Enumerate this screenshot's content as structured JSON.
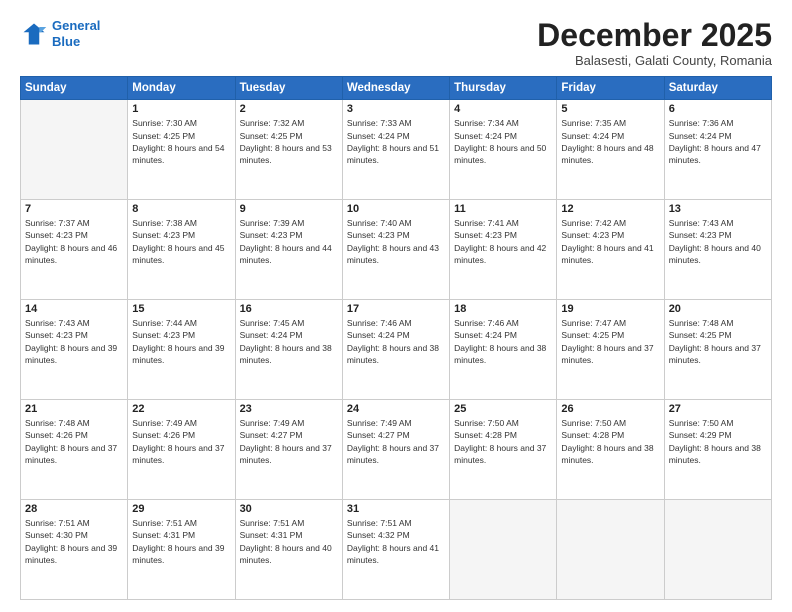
{
  "logo": {
    "line1": "General",
    "line2": "Blue"
  },
  "header": {
    "month": "December 2025",
    "location": "Balasesti, Galati County, Romania"
  },
  "weekdays": [
    "Sunday",
    "Monday",
    "Tuesday",
    "Wednesday",
    "Thursday",
    "Friday",
    "Saturday"
  ],
  "weeks": [
    [
      {
        "day": "",
        "empty": true
      },
      {
        "day": "1",
        "sunrise": "7:30 AM",
        "sunset": "4:25 PM",
        "daylight": "8 hours and 54 minutes."
      },
      {
        "day": "2",
        "sunrise": "7:32 AM",
        "sunset": "4:25 PM",
        "daylight": "8 hours and 53 minutes."
      },
      {
        "day": "3",
        "sunrise": "7:33 AM",
        "sunset": "4:24 PM",
        "daylight": "8 hours and 51 minutes."
      },
      {
        "day": "4",
        "sunrise": "7:34 AM",
        "sunset": "4:24 PM",
        "daylight": "8 hours and 50 minutes."
      },
      {
        "day": "5",
        "sunrise": "7:35 AM",
        "sunset": "4:24 PM",
        "daylight": "8 hours and 48 minutes."
      },
      {
        "day": "6",
        "sunrise": "7:36 AM",
        "sunset": "4:24 PM",
        "daylight": "8 hours and 47 minutes."
      }
    ],
    [
      {
        "day": "7",
        "sunrise": "7:37 AM",
        "sunset": "4:23 PM",
        "daylight": "8 hours and 46 minutes."
      },
      {
        "day": "8",
        "sunrise": "7:38 AM",
        "sunset": "4:23 PM",
        "daylight": "8 hours and 45 minutes."
      },
      {
        "day": "9",
        "sunrise": "7:39 AM",
        "sunset": "4:23 PM",
        "daylight": "8 hours and 44 minutes."
      },
      {
        "day": "10",
        "sunrise": "7:40 AM",
        "sunset": "4:23 PM",
        "daylight": "8 hours and 43 minutes."
      },
      {
        "day": "11",
        "sunrise": "7:41 AM",
        "sunset": "4:23 PM",
        "daylight": "8 hours and 42 minutes."
      },
      {
        "day": "12",
        "sunrise": "7:42 AM",
        "sunset": "4:23 PM",
        "daylight": "8 hours and 41 minutes."
      },
      {
        "day": "13",
        "sunrise": "7:43 AM",
        "sunset": "4:23 PM",
        "daylight": "8 hours and 40 minutes."
      }
    ],
    [
      {
        "day": "14",
        "sunrise": "7:43 AM",
        "sunset": "4:23 PM",
        "daylight": "8 hours and 39 minutes."
      },
      {
        "day": "15",
        "sunrise": "7:44 AM",
        "sunset": "4:23 PM",
        "daylight": "8 hours and 39 minutes."
      },
      {
        "day": "16",
        "sunrise": "7:45 AM",
        "sunset": "4:24 PM",
        "daylight": "8 hours and 38 minutes."
      },
      {
        "day": "17",
        "sunrise": "7:46 AM",
        "sunset": "4:24 PM",
        "daylight": "8 hours and 38 minutes."
      },
      {
        "day": "18",
        "sunrise": "7:46 AM",
        "sunset": "4:24 PM",
        "daylight": "8 hours and 38 minutes."
      },
      {
        "day": "19",
        "sunrise": "7:47 AM",
        "sunset": "4:25 PM",
        "daylight": "8 hours and 37 minutes."
      },
      {
        "day": "20",
        "sunrise": "7:48 AM",
        "sunset": "4:25 PM",
        "daylight": "8 hours and 37 minutes."
      }
    ],
    [
      {
        "day": "21",
        "sunrise": "7:48 AM",
        "sunset": "4:26 PM",
        "daylight": "8 hours and 37 minutes."
      },
      {
        "day": "22",
        "sunrise": "7:49 AM",
        "sunset": "4:26 PM",
        "daylight": "8 hours and 37 minutes."
      },
      {
        "day": "23",
        "sunrise": "7:49 AM",
        "sunset": "4:27 PM",
        "daylight": "8 hours and 37 minutes."
      },
      {
        "day": "24",
        "sunrise": "7:49 AM",
        "sunset": "4:27 PM",
        "daylight": "8 hours and 37 minutes."
      },
      {
        "day": "25",
        "sunrise": "7:50 AM",
        "sunset": "4:28 PM",
        "daylight": "8 hours and 37 minutes."
      },
      {
        "day": "26",
        "sunrise": "7:50 AM",
        "sunset": "4:28 PM",
        "daylight": "8 hours and 38 minutes."
      },
      {
        "day": "27",
        "sunrise": "7:50 AM",
        "sunset": "4:29 PM",
        "daylight": "8 hours and 38 minutes."
      }
    ],
    [
      {
        "day": "28",
        "sunrise": "7:51 AM",
        "sunset": "4:30 PM",
        "daylight": "8 hours and 39 minutes."
      },
      {
        "day": "29",
        "sunrise": "7:51 AM",
        "sunset": "4:31 PM",
        "daylight": "8 hours and 39 minutes."
      },
      {
        "day": "30",
        "sunrise": "7:51 AM",
        "sunset": "4:31 PM",
        "daylight": "8 hours and 40 minutes."
      },
      {
        "day": "31",
        "sunrise": "7:51 AM",
        "sunset": "4:32 PM",
        "daylight": "8 hours and 41 minutes."
      },
      {
        "day": "",
        "empty": true
      },
      {
        "day": "",
        "empty": true
      },
      {
        "day": "",
        "empty": true
      }
    ]
  ]
}
